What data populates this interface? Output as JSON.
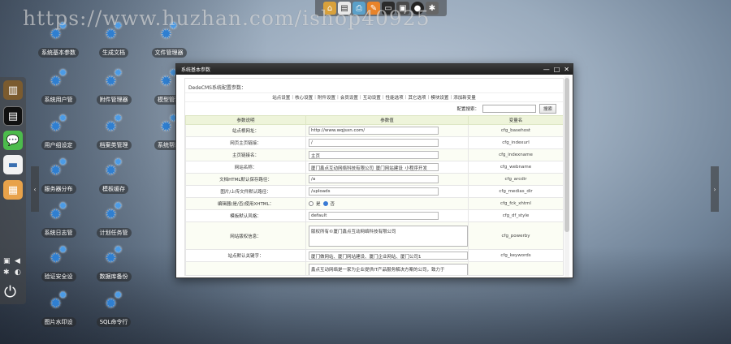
{
  "watermark": "https://www.huzhan.com/ishop40925",
  "top_dock": [
    "home-icon",
    "document-icon",
    "printer-icon",
    "pen-icon",
    "card-icon",
    "screen-icon",
    "ball-icon",
    "gear-icon"
  ],
  "desktop_icons": [
    {
      "label": "系统基本参数"
    },
    {
      "label": "生成文档"
    },
    {
      "label": "文件管理器"
    },
    {
      "label": "系统用户管"
    },
    {
      "label": "附件管理器"
    },
    {
      "label": "模型管理"
    },
    {
      "label": "用户组设定"
    },
    {
      "label": "档案类管理"
    },
    {
      "label": "系统帮助"
    },
    {
      "label": "服务器分布"
    },
    {
      "label": "模板缓存"
    },
    {
      "label": "系统日志管"
    },
    {
      "label": "计划任务管"
    },
    {
      "label": "验证安全设"
    },
    {
      "label": "数据库备份"
    },
    {
      "label": "图片水印设"
    },
    {
      "label": "SQL命令行"
    }
  ],
  "window": {
    "title": "系统基本参数",
    "breadcrumb": "DedeCMS系统配置参数：",
    "tabs": [
      "站点设置",
      "核心设置",
      "附件设置",
      "会员设置",
      "互动设置",
      "性能选项",
      "其它选项",
      "模块设置",
      "添加新变量"
    ],
    "search_label": "配置搜索：",
    "search_button": "搜索",
    "columns": [
      "参数说明",
      "参数值",
      "变量名"
    ],
    "rows": [
      {
        "label": "站点根网址：",
        "value": "http://www.wqjsxn.com/",
        "var": "cfg_basehost"
      },
      {
        "label": "网页主页链接：",
        "value": "/",
        "var": "cfg_indexurl"
      },
      {
        "label": "主页链接名：",
        "value": "主页",
        "var": "cfg_indexname"
      },
      {
        "label": "网站名称：",
        "value": "厦门鑫点互动网络科技有限公司_厦门网站建设_小程序开发",
        "var": "cfg_webname"
      },
      {
        "label": "文档HTML默认保存路径：",
        "value": "/a",
        "var": "cfg_arcdir"
      },
      {
        "label": "图片/上传文件默认路径：",
        "value": "/uploads",
        "var": "cfg_medias_dir"
      },
      {
        "label": "编辑器(是/否)使用XHTML：",
        "value_yes": "是",
        "value_no": "否",
        "var": "cfg_fck_xhtml"
      },
      {
        "label": "模板默认风格：",
        "value": "default",
        "var": "cfg_df_style"
      },
      {
        "label": "网站版权信息：",
        "value": "版权所有©厦门鑫点互动网络科技有限公司",
        "var": "cfg_powerby"
      },
      {
        "label": "站点默认关键字：",
        "value": "厦门做网站、厦门网站建设、厦门企业网站、厦门公司1",
        "var": "cfg_keywords"
      },
      {
        "label": "",
        "value": "鑫点互动网络是一家为企业提供IT产品服务解决方案的公司，致力于",
        "var": ""
      }
    ]
  }
}
